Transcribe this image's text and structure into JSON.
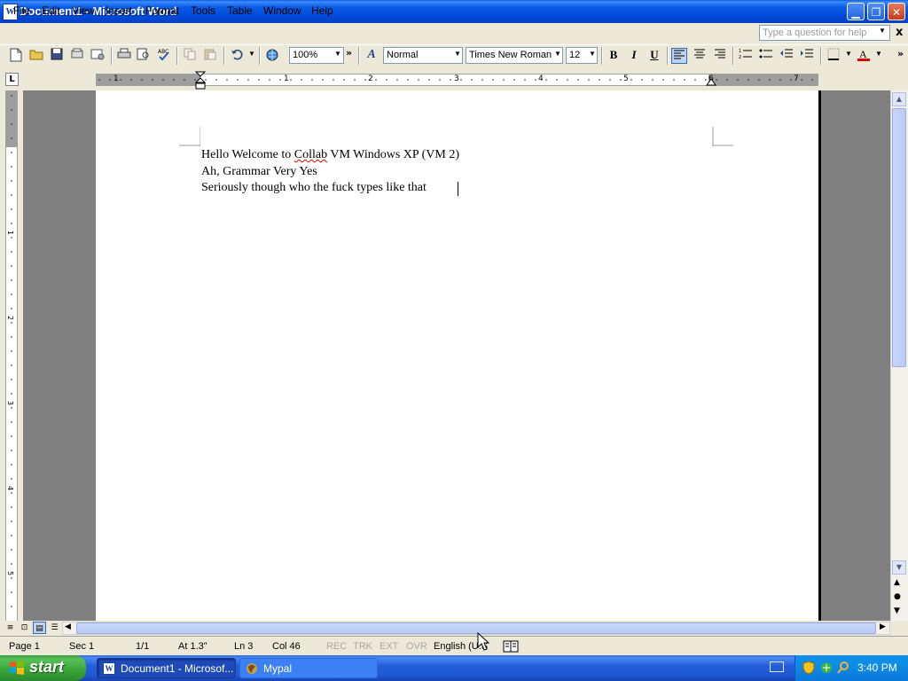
{
  "window": {
    "title": "Document1 - Microsoft Word",
    "minimize": "▁",
    "maximize": "❐",
    "close": "✕",
    "app_icon_letter": "W"
  },
  "menubar": {
    "items": [
      "File",
      "Edit",
      "View",
      "Insert",
      "Format",
      "Tools",
      "Table",
      "Window",
      "Help"
    ],
    "help_placeholder": "Type a question for help",
    "close_doc": "x"
  },
  "toolbar": {
    "zoom": "100%",
    "style": "Normal",
    "font": "Times New Roman",
    "size": "12",
    "bold": "B",
    "italic": "I",
    "underline": "U",
    "overflow": "»"
  },
  "ruler": {
    "tab_selector": "L",
    "h_numbers": [
      "1",
      "1",
      "2",
      "3",
      "4",
      "5",
      "6",
      "7"
    ],
    "v_numbers": [
      "1",
      "2",
      "3",
      "4",
      "5"
    ]
  },
  "document": {
    "lines": [
      {
        "before": "Hello Welcome to ",
        "flagged": "Collab",
        "after": " VM Windows XP (VM 2)"
      },
      {
        "before": "Ah, Grammar Very Yes",
        "flagged": "",
        "after": ""
      },
      {
        "before": "Seriously though who the fuck types like that",
        "flagged": "",
        "after": ""
      }
    ]
  },
  "statusbar": {
    "page": "Page  1",
    "sec": "Sec  1",
    "pages": "1/1",
    "at": "At  1.3\"",
    "ln": "Ln  3",
    "col": "Col  46",
    "rec": "REC",
    "trk": "TRK",
    "ext": "EXT",
    "ovr": "OVR",
    "language": "English (U.S"
  },
  "taskbar": {
    "start": "start",
    "tasks": [
      {
        "label": "Document1 - Microsof..."
      },
      {
        "label": "Mypal"
      }
    ],
    "clock": "3:40 PM"
  },
  "colors": {
    "title_blue": "#0a5de8",
    "taskbar_blue": "#245edb",
    "start_green": "#38a538",
    "font_color_red": "#e00000"
  }
}
